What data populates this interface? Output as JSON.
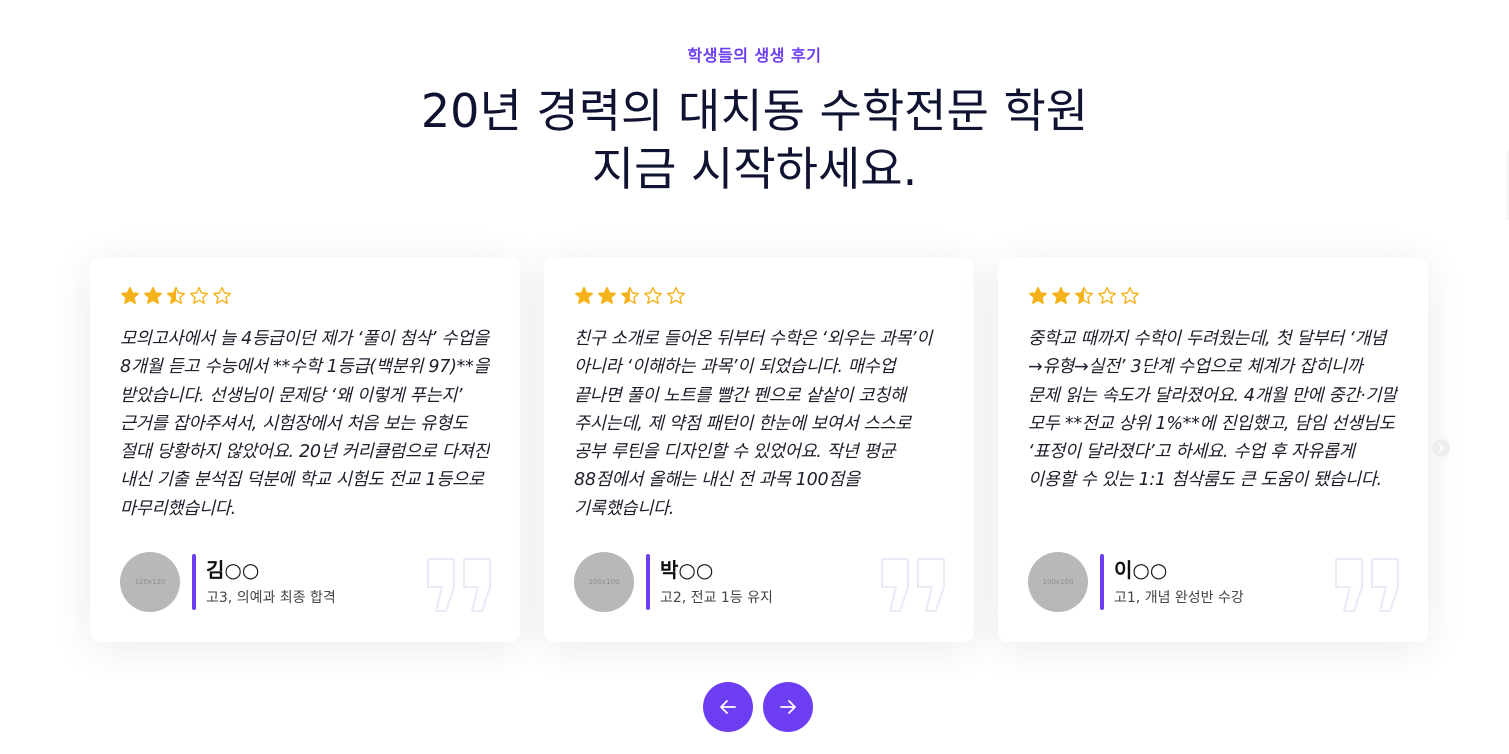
{
  "header": {
    "eyebrow": "학생들의 생생 후기",
    "title_line1": "20년 경력의 대치동 수학전문 학원",
    "title_line2": "지금 시작하세요."
  },
  "colors": {
    "accent": "#6d3df2",
    "star": "#f5b21b",
    "avatar": "#b8b8b8"
  },
  "reviews": [
    {
      "rating": 2.5,
      "text": "모의고사에서 늘 4등급이던 제가 ‘풀이 첨삭’ 수업을 8개월 듣고 수능에서 **수학 1등급(백분위 97)**을 받았습니다. 선생님이 문제당 ‘왜 이렇게 푸는지’ 근거를 잡아주셔서, 시험장에서 처음 보는 유형도 절대 당황하지 않았어요. 20년 커리큘럼으로 다져진 내신 기출 분석집 덕분에 학교 시험도 전교 1등으로 마무리했습니다.",
      "avatar_label": "120x120",
      "name": "김○○",
      "desc": "고3, 의예과 최종 합격"
    },
    {
      "rating": 2.5,
      "text": "친구 소개로 들어온 뒤부터 수학은 ‘외우는 과목’이 아니라 ‘이해하는 과목’이 되었습니다. 매수업 끝나면 풀이 노트를 빨간 펜으로 샅샅이 코칭해 주시는데, 제 약점 패턴이 한눈에 보여서 스스로 공부 루틴을 디자인할 수 있었어요. 작년 평균 88점에서 올해는 내신 전 과목 100점을 기록했습니다.",
      "avatar_label": "100x100",
      "name": "박○○",
      "desc": "고2, 전교 1등 유지"
    },
    {
      "rating": 2.5,
      "text": "중학교 때까지 수학이 두려웠는데, 첫 달부터 ‘개념→유형→실전’ 3단계 수업으로 체계가 잡히니까 문제 읽는 속도가 달라졌어요. 4개월 만에 중간·기말 모두 **전교 상위 1%**에 진입했고, 담임 선생님도 ‘표정이 달라졌다’고 하세요. 수업 후 자유롭게 이용할 수 있는 1:1 첨삭룸도 큰 도움이 됐습니다.",
      "avatar_label": "100x100",
      "name": "이○○",
      "desc": "고1, 개념 완성반 수강"
    }
  ],
  "icons": {
    "star": "star-icon",
    "quote": "quote-icon",
    "prev": "arrow-left-icon",
    "next": "arrow-right-icon",
    "side": "chevron-right-icon"
  }
}
